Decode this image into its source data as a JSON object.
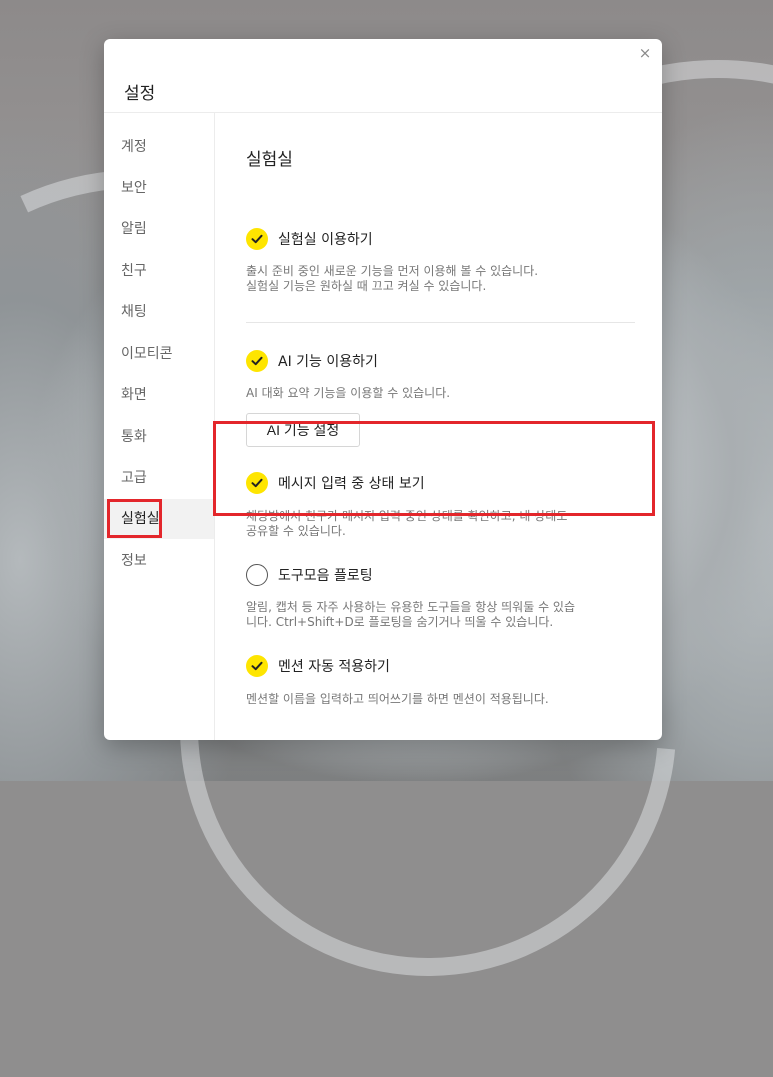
{
  "dialog": {
    "title": "설정",
    "close_icon": "×"
  },
  "sidebar": {
    "items": [
      {
        "label": "계정"
      },
      {
        "label": "보안"
      },
      {
        "label": "알림"
      },
      {
        "label": "친구"
      },
      {
        "label": "채팅"
      },
      {
        "label": "이모티콘"
      },
      {
        "label": "화면"
      },
      {
        "label": "통화"
      },
      {
        "label": "고급"
      },
      {
        "label": "실험실",
        "selected": true
      },
      {
        "label": "정보"
      }
    ]
  },
  "content": {
    "section_title": "실험실",
    "options": [
      {
        "label": "실험실 이용하기",
        "checked": true,
        "description": [
          "출시 준비 중인 새로운 기능을 먼저 이용해 볼 수 있습니다.",
          "실험실 기능은 원하실 때 끄고 켜실 수 있습니다."
        ]
      },
      {
        "label": "AI 기능 이용하기",
        "checked": true,
        "description": [
          "AI 대화 요약 기능을 이용할 수 있습니다."
        ],
        "button": "AI 기능 설정"
      },
      {
        "label": "메시지 입력 중 상태 보기",
        "checked": true,
        "description": [
          "채팅방에서 친구가 메시지 입력 중인 상태를 확인하고, 내 상태도",
          "공유할 수 있습니다."
        ]
      },
      {
        "label": "도구모음 플로팅",
        "checked": false,
        "description": [
          "알림, 캡처 등 자주 사용하는 유용한 도구들을 항상 띄워둘 수 있습",
          "니다. Ctrl+Shift+D로 플로팅을 숨기거나 띄울 수 있습니다."
        ]
      },
      {
        "label": "멘션 자동 적용하기",
        "checked": true,
        "description": [
          "멘션할 이름을 입력하고 띄어쓰기를 하면 멘션이 적용됩니다."
        ]
      }
    ]
  },
  "icons": {
    "check": "check-icon",
    "close": "close-icon"
  },
  "colors": {
    "accent": "#fee500",
    "highlight": "#e3262b"
  }
}
